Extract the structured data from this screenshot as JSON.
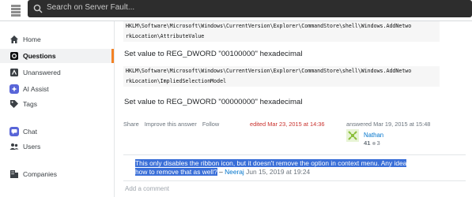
{
  "search": {
    "placeholder": "Search on Server Fault..."
  },
  "sidebar": {
    "items": [
      {
        "label": "Home",
        "icon": "home-icon"
      },
      {
        "label": "Questions",
        "icon": "questions-icon",
        "active": true
      },
      {
        "label": "Unanswered",
        "icon": "unanswered-icon"
      },
      {
        "label": "AI Assist",
        "icon": "ai-assist-icon"
      },
      {
        "label": "Tags",
        "icon": "tag-icon"
      },
      {
        "label": "Chat",
        "icon": "chat-icon"
      },
      {
        "label": "Users",
        "icon": "users-icon"
      },
      {
        "label": "Companies",
        "icon": "companies-icon"
      }
    ]
  },
  "answer": {
    "code1_line1": "HKLM\\Software\\Microsoft\\Windows\\CurrentVersion\\Explorer\\CommandStore\\shell\\Windows.AddNetwo",
    "code1_line2": "rkLocation\\AttributeValue",
    "para1": "Set value to REG_DWORD \"00100000\" hexadecimal",
    "code2_line1": "HKLM\\Software\\Microsoft\\Windows\\CurrentVersion\\Explorer\\CommandStore\\shell\\Windows.AddNetwo",
    "code2_line2": "rkLocation\\ImpliedSelectionModel",
    "para2": "Set value to REG_DWORD \"00000000\" hexadecimal"
  },
  "post_menu": {
    "share": "Share",
    "improve": "Improve this answer",
    "follow": "Follow",
    "edited": "edited Mar 23, 2015 at 14:36",
    "answered": "answered Mar 19, 2015 at 15:48",
    "username": "Nathan",
    "reputation": "41",
    "bronze_badges": "3"
  },
  "comment": {
    "text": "This only disables the ribbon icon, but it doesn't remove the option in context menu. Any idea how to remove that as well?",
    "separator": " – ",
    "author": "Neeraj",
    "date": "Jun 15, 2019 at 19:24"
  },
  "add_comment": "Add a comment",
  "colors": {
    "accent": "#f48225",
    "link": "#0074cc",
    "edited": "#c9302c",
    "selection": "#3a6fd8"
  }
}
